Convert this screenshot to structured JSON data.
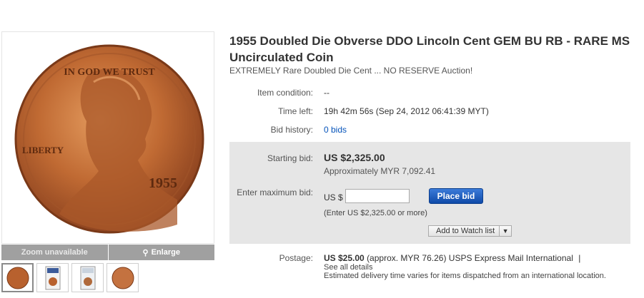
{
  "gallery": {
    "zoom_label": "Zoom unavailable",
    "enlarge_label": "Enlarge",
    "coin_year": "1955",
    "coin_motto": "IN GOD WE TRUST",
    "coin_liberty": "LIBERTY"
  },
  "listing": {
    "title": "1955 Doubled Die Obverse DDO Lincoln Cent GEM BU RB - RARE MS Uncirculated Coin",
    "subtitle": "EXTREMELY Rare Doubled Die Cent ... NO RESERVE Auction!",
    "condition_label": "Item condition:",
    "condition_value": "--",
    "time_label": "Time left:",
    "time_value": "19h 42m 56s (Sep 24, 2012 06:41:39 MYT)",
    "history_label": "Bid history:",
    "history_value": "0 bids"
  },
  "bid": {
    "starting_label": "Starting bid:",
    "starting_price": "US $2,325.00",
    "approx": "Approximately MYR 7,092.41",
    "max_label": "Enter maximum bid:",
    "currency_prefix": "US $",
    "input_value": "",
    "place_bid_label": "Place bid",
    "hint": "(Enter US $2,325.00 or more)",
    "watch_label": "Add to Watch list"
  },
  "postage": {
    "label": "Postage:",
    "amount": "US $25.00",
    "detail": "(approx. MYR 76.26) USPS Express Mail International",
    "separator": "|",
    "see_all": "See all details",
    "note": "Estimated delivery time varies for items dispatched from an international location."
  },
  "colors": {
    "link": "#0654ba",
    "button": "#1a5bbd",
    "bidbox": "#e6e6e6",
    "coin": "#b8612e"
  }
}
